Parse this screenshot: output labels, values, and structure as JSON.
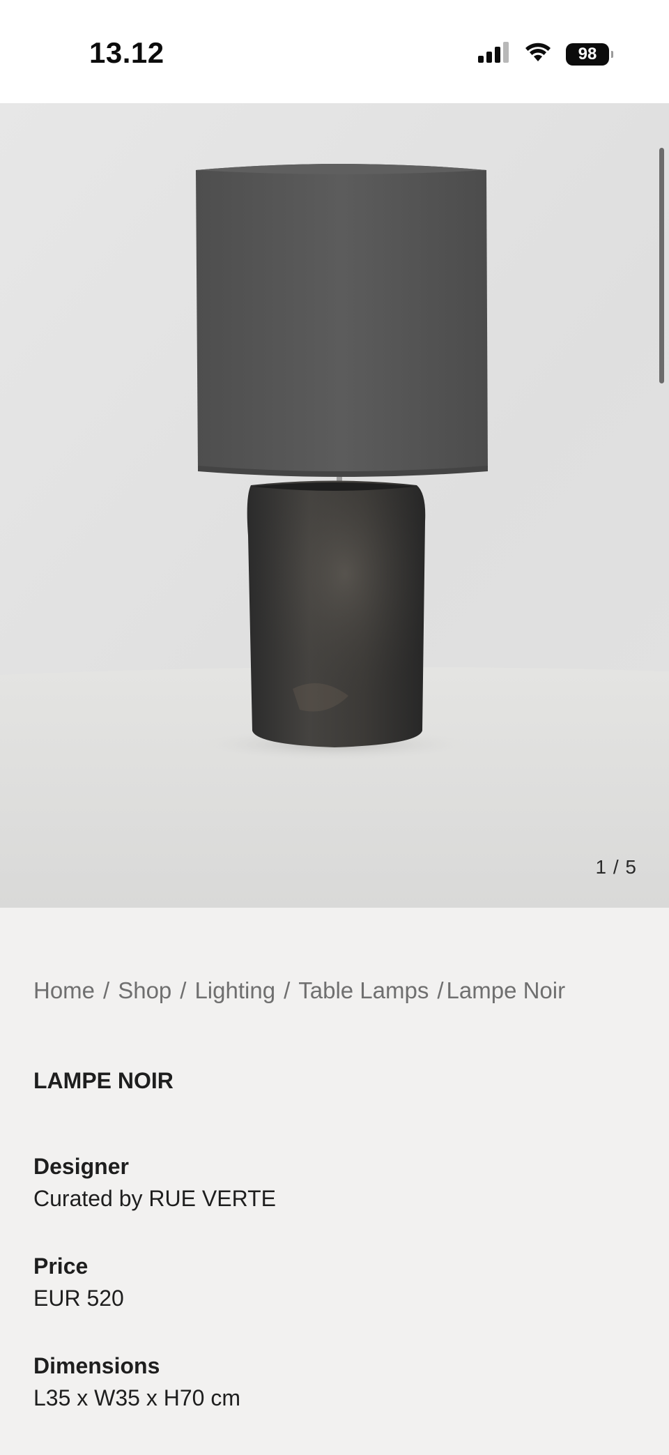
{
  "status_bar": {
    "time": "13.12",
    "battery": "98",
    "icons": [
      "signal-icon",
      "wifi-icon",
      "battery-icon"
    ]
  },
  "gallery": {
    "counter": "1 / 5",
    "current": 1,
    "total": 5
  },
  "breadcrumb": {
    "items": [
      "Home",
      "Shop",
      "Lighting",
      "Table Lamps",
      "Lampe Noir"
    ],
    "separator": "/"
  },
  "product": {
    "title": "LAMPE NOIR",
    "designer_label": "Designer",
    "designer_value": "Curated by RUE VERTE",
    "price_label": "Price",
    "price_value": "EUR 520",
    "dimensions_label": "Dimensions",
    "dimensions_value": "L35 x W35 x H70 cm"
  },
  "colors": {
    "background": "#f2f1f0",
    "text": "#1e1e1e",
    "muted_text": "#6f6f6f",
    "status_bar": "#ffffff"
  }
}
